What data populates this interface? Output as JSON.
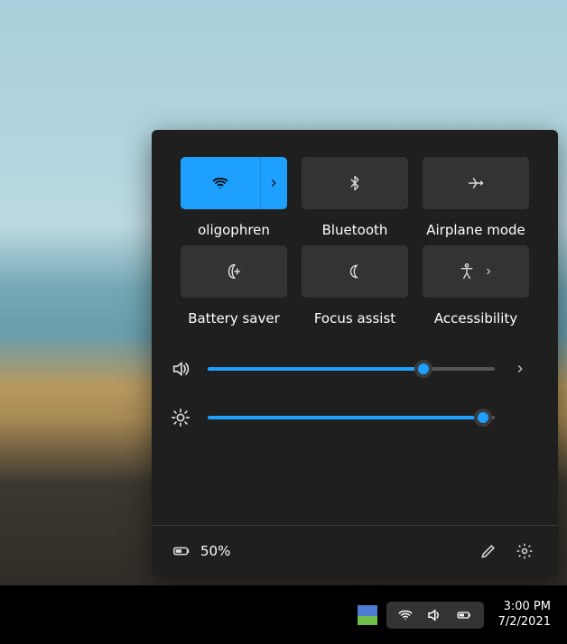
{
  "panel": {
    "tiles": {
      "wifi": {
        "label": "oligophren",
        "active": true
      },
      "bluetooth": {
        "label": "Bluetooth",
        "active": false
      },
      "airplane": {
        "label": "Airplane mode",
        "active": false
      },
      "battery": {
        "label": "Battery saver",
        "active": false
      },
      "focus": {
        "label": "Focus assist",
        "active": false
      },
      "a11y": {
        "label": "Accessibility",
        "active": false
      }
    },
    "sliders": {
      "volume": {
        "percent": 75
      },
      "brightness": {
        "percent": 96
      }
    },
    "footer": {
      "battery_pct": "50%"
    }
  },
  "tray": {
    "time": "3:00 PM",
    "date": "7/2/2021"
  },
  "colors": {
    "accent": "#1ea0ff"
  }
}
